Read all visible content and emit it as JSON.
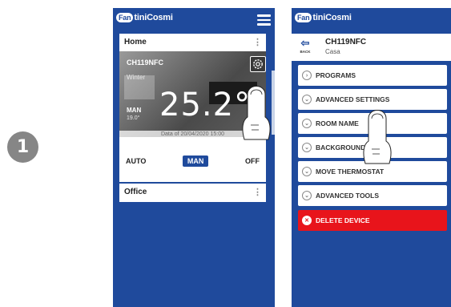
{
  "step": {
    "number": "1"
  },
  "colors": {
    "brand_blue": "#1f4a9c",
    "danger_red": "#e8141b",
    "step_gray": "#868686"
  },
  "phone1": {
    "logo_badge": "Fan",
    "logo_rest": "tiniCosmi",
    "home_card": {
      "title": "Home",
      "kebab": "⋮",
      "device_name": "CH119NFC",
      "season": "Winter",
      "mode": "MAN",
      "setpoint": "19.0°",
      "temperature": "25.2°",
      "data_footer": "Data of 20/04/2020 15:00",
      "mode_buttons": [
        "AUTO",
        "MAN",
        "OFF"
      ]
    },
    "office_card": {
      "title": "Office",
      "kebab": "⋮"
    }
  },
  "phone2": {
    "logo_badge": "Fan",
    "logo_rest": "tiniCosmi",
    "back_label": "BACK",
    "device_title": "CH119NFC",
    "device_subtitle": "Casa",
    "menu": [
      {
        "label": "PROGRAMS",
        "icon": "chevron-right-icon"
      },
      {
        "label": "ADVANCED SETTINGS",
        "icon": "chevron-down-icon"
      },
      {
        "label": "ROOM NAME",
        "icon": "chevron-down-icon"
      },
      {
        "label": "BACKGROUND",
        "icon": "chevron-down-icon"
      },
      {
        "label": "MOVE THERMOSTAT",
        "icon": "chevron-down-icon"
      },
      {
        "label": "ADVANCED TOOLS",
        "icon": "chevron-down-icon"
      }
    ],
    "delete_label": "DELETE DEVICE"
  }
}
